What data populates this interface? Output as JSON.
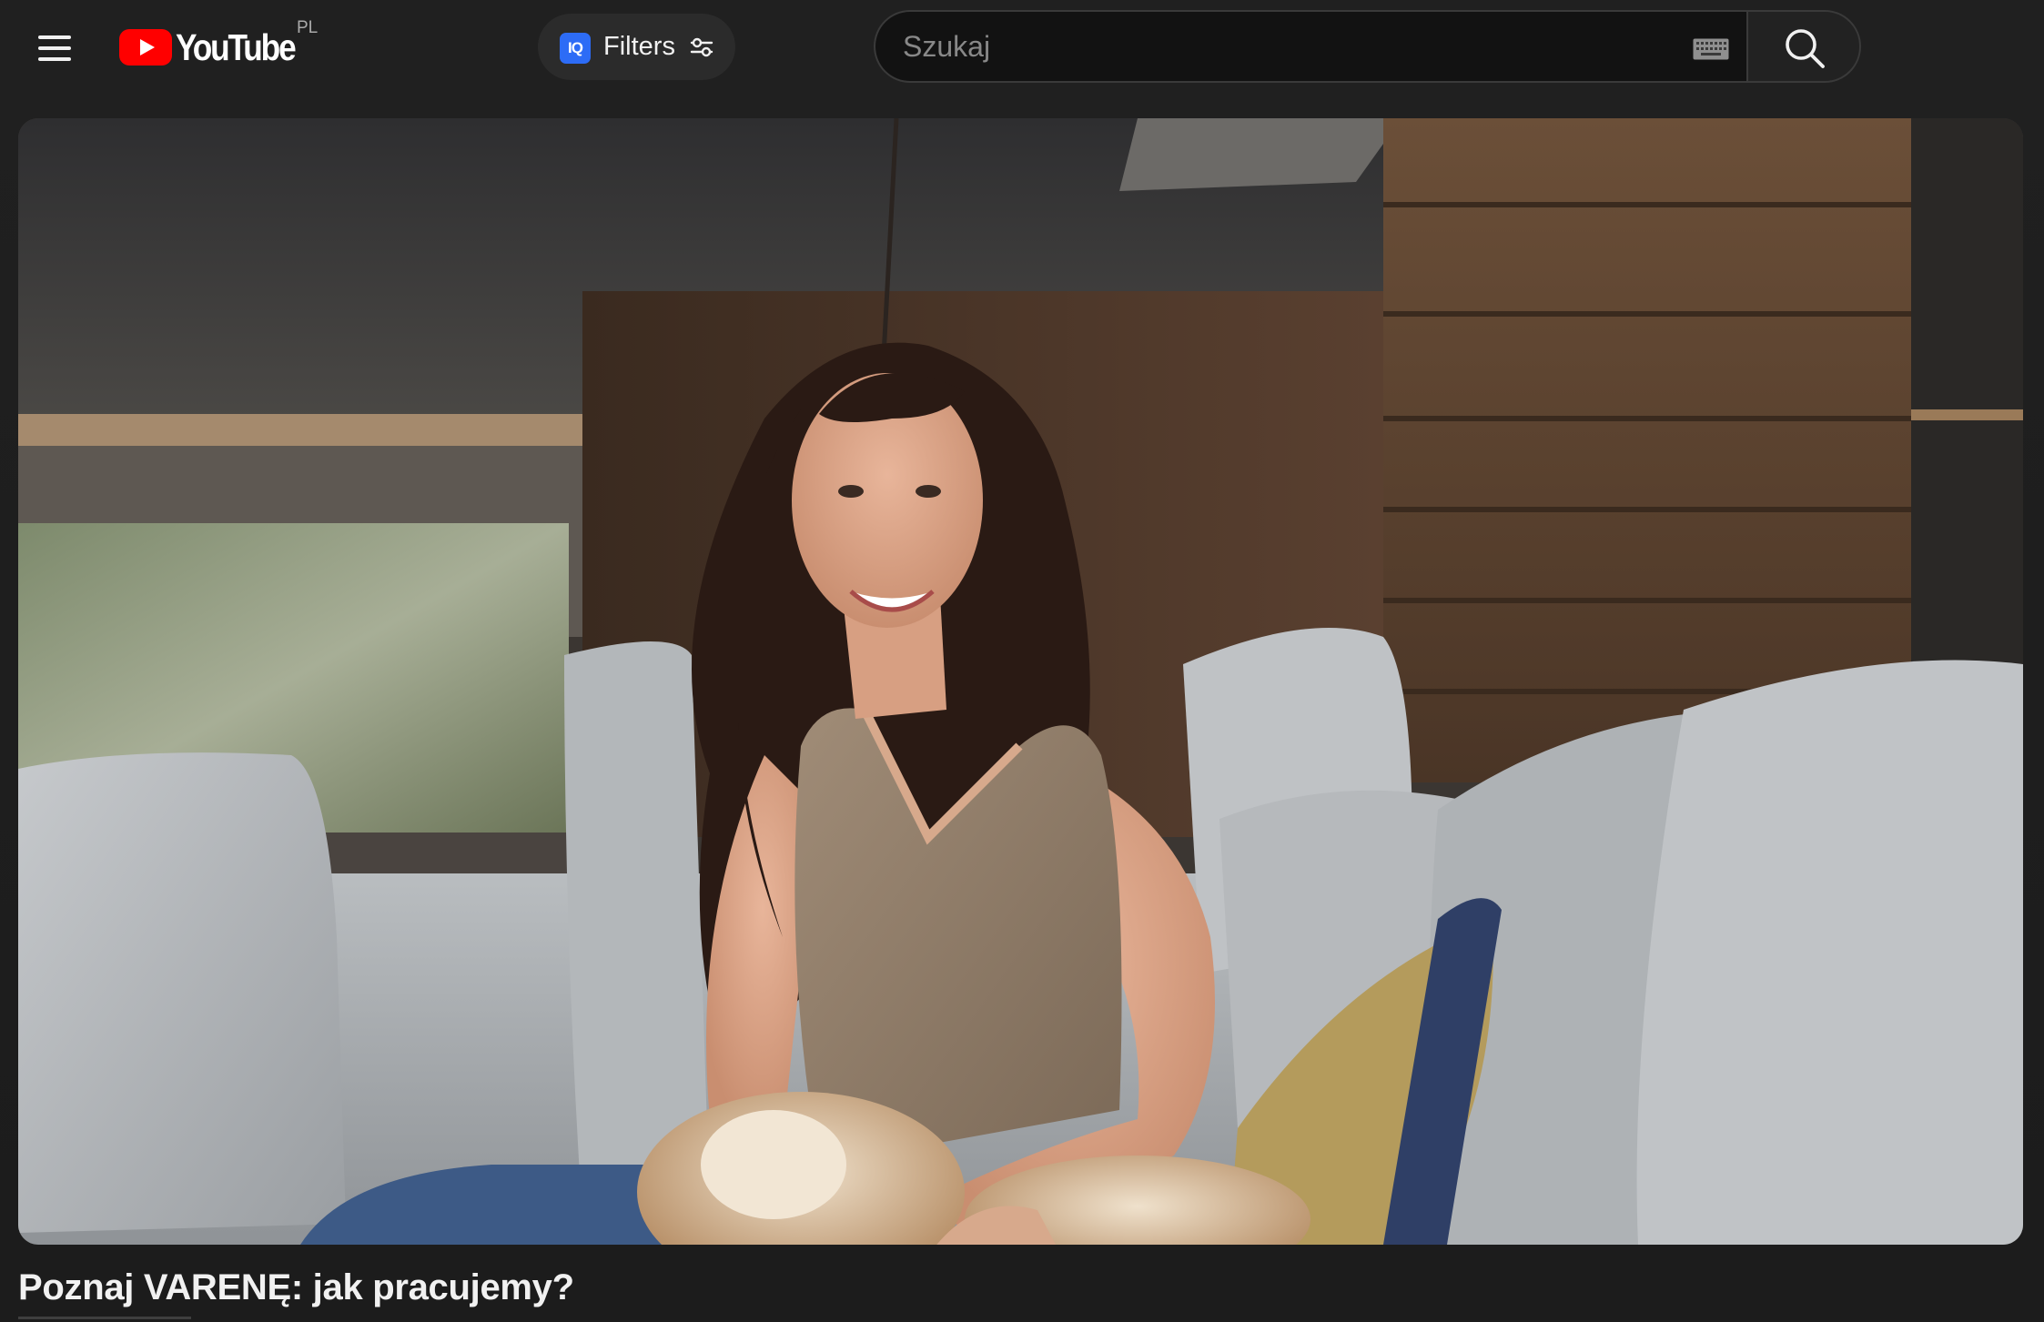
{
  "masthead": {
    "logo_text": "YouTube",
    "country_code": "PL",
    "filters_badge": "IQ",
    "filters_label": "Filters",
    "search_placeholder": "Szukaj",
    "search_value": ""
  },
  "video": {
    "title": "Poznaj VARENĘ: jak pracujemy?"
  },
  "colors": {
    "background": "#1f1f1f",
    "brand_red": "#ff0000",
    "filters_accent": "#2d6cf6",
    "text": "#f1f1f1"
  },
  "icons": [
    "menu-icon",
    "youtube-logo-icon",
    "iq-icon",
    "sliders-icon",
    "keyboard-icon",
    "search-icon"
  ]
}
